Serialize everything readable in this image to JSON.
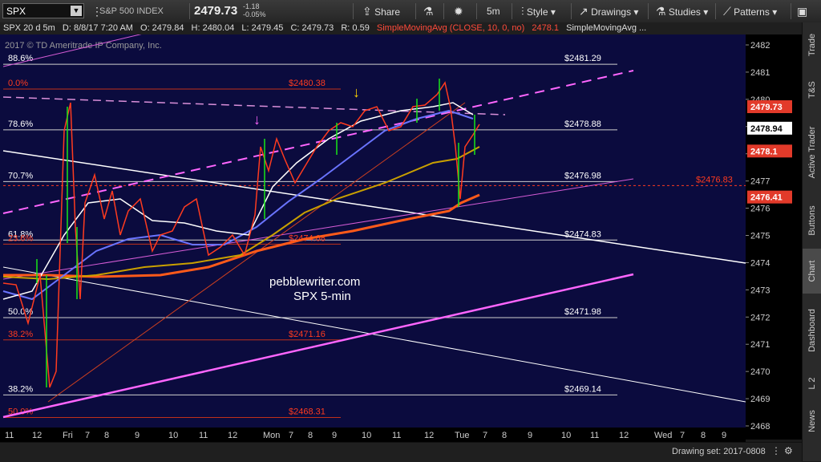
{
  "toolbar": {
    "symbol": "SPX",
    "description": "S&P 500 INDEX",
    "last_price": "2479.73",
    "change": "-1.18",
    "change_pct": "-0.05%",
    "share_label": "Share",
    "interval_label": "5m",
    "style_label": "Style",
    "drawings_label": "Drawings",
    "studies_label": "Studies",
    "patterns_label": "Patterns"
  },
  "info_bar": {
    "chart_name": "SPX 20 d 5m",
    "datetime": "D: 8/8/17 7:20 AM",
    "open": "O: 2479.84",
    "high": "H: 2480.04",
    "low": "L: 2479.45",
    "close": "C: 2479.73",
    "range": "R: 0.59",
    "study1": "SimpleMovingAvg (CLOSE, 10, 0, no)",
    "study1_value": "2478.1",
    "study2": "SimpleMovingAvg ..."
  },
  "copyright": "2017 © TD Ameritrade IP Company, Inc.",
  "watermark": {
    "line1": "pebblewriter.com",
    "line2": "SPX 5-min"
  },
  "fib_labels": [
    {
      "pct": "88.6%",
      "price": "$2481.29",
      "y": 2481.29,
      "color": "#ffffff"
    },
    {
      "pct": "0.0%",
      "price": "$2480.38",
      "y": 2480.38,
      "color": "#ff3b1f"
    },
    {
      "pct": "78.6%",
      "price": "$2478.88",
      "y": 2478.88,
      "color": "#ffffff"
    },
    {
      "pct": "70.7%",
      "price": "$2476.98",
      "y": 2476.98,
      "color": "#ffffff"
    },
    {
      "pct": "61.8%",
      "price": "$2474.83",
      "y": 2474.83,
      "color": "#ffffff"
    },
    {
      "pct": "23.6%",
      "price": "$2474.68",
      "y": 2474.68,
      "color": "#ff3b1f"
    },
    {
      "pct": "50.0%",
      "price": "$2471.98",
      "y": 2471.98,
      "color": "#ffffff"
    },
    {
      "pct": "38.2%",
      "price": "$2471.16",
      "y": 2471.16,
      "color": "#ff3b1f"
    },
    {
      "pct": "38.2%",
      "price": "$2469.14",
      "y": 2469.14,
      "color": "#ffffff"
    },
    {
      "pct": "50.0%",
      "price": "$2468.31",
      "y": 2468.31,
      "color": "#ff3b1f"
    }
  ],
  "extra_labels": {
    "dotted_price": "$2476.83",
    "obscured_pct": "0.0%"
  },
  "price_axis": {
    "ticks": [
      "2482",
      "2481",
      "2480",
      "2479",
      "2478",
      "2477",
      "2476",
      "2475",
      "2474",
      "2473",
      "2472",
      "2471",
      "2470",
      "2469",
      "2468"
    ],
    "tags": [
      {
        "label": "2479.73",
        "y": 2479.73,
        "bg": "#e23a2a",
        "fg": "#ffffff"
      },
      {
        "label": "2478.94",
        "y": 2478.94,
        "bg": "#ffffff",
        "fg": "#000000"
      },
      {
        "label": "2478.1",
        "y": 2478.1,
        "bg": "#e23a2a",
        "fg": "#ffffff"
      },
      {
        "label": "2476.41",
        "y": 2476.41,
        "bg": "#e23a2a",
        "fg": "#ffffff"
      }
    ]
  },
  "time_axis": [
    "11",
    "12",
    "Fri",
    "7",
    "8",
    "9",
    "10",
    "11",
    "12",
    "Mon",
    "7",
    "8",
    "9",
    "10",
    "11",
    "12",
    "Tue",
    "7",
    "8",
    "9",
    "10",
    "11",
    "12",
    "Wed",
    "7",
    "8",
    "9"
  ],
  "sidebar": [
    "Trade",
    "T&S",
    "Active Trader",
    "Buttons",
    "Chart",
    "Dashboard",
    "L 2",
    "News"
  ],
  "status": {
    "drawing_set": "Drawing set: 2017-0808"
  },
  "colors": {
    "background": "#0b0b3e",
    "price_line": "#ff3b1f",
    "sma_white": "#ffffff",
    "sma_blue": "#6a74ff",
    "sma_gold": "#c9a000",
    "sma_orange": "#ff5a1a",
    "channel": "#ff66ff"
  },
  "icons": [
    "dropdown-icon",
    "settings-icon",
    "share-icon",
    "flask-icon",
    "gear-icon",
    "style-icon",
    "drawings-icon",
    "studies-icon",
    "patterns-icon",
    "down-arrow-icon"
  ]
}
